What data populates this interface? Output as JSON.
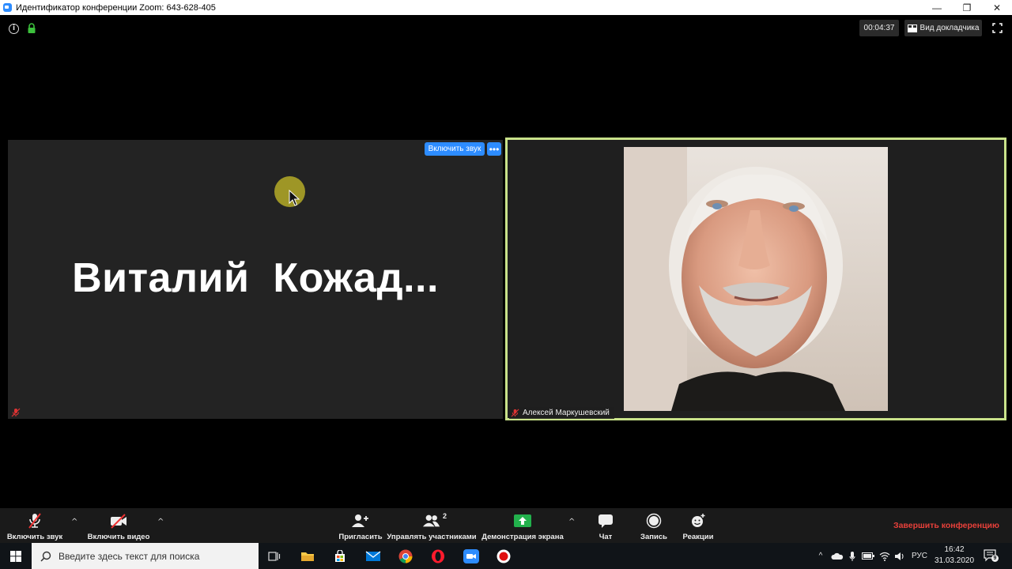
{
  "window": {
    "title": "Идентификатор конференции Zoom: 643-628-405"
  },
  "topbar": {
    "timer": "00:04:37",
    "speaker_view_label": "Вид докладчика"
  },
  "left_tile": {
    "unmute_label": "Включить звук",
    "more_label": "•••",
    "participant_name": "Виталий  Кожад..."
  },
  "right_tile": {
    "participant_name": "Алексей Маркушевский",
    "border_color": "#c9e28a"
  },
  "toolbar": {
    "audio_label": "Включить звук",
    "video_label": "Включить видео",
    "invite_label": "Пригласить",
    "participants_label": "Управлять участниками",
    "participants_count": "2",
    "share_label": "Демонстрация экрана",
    "chat_label": "Чат",
    "record_label": "Запись",
    "reactions_label": "Реакции",
    "end_label": "Завершить конференцию",
    "end_color": "#e8403a",
    "share_color": "#22b14c"
  },
  "taskbar": {
    "search_placeholder": "Введите здесь текст для поиска",
    "language": "РУС",
    "time": "16:42",
    "date": "31.03.2020",
    "notification_count": "9"
  },
  "icons": [
    "info-icon",
    "lock-icon",
    "grid-icon",
    "fullscreen-icon",
    "mic-muted-icon",
    "video-off-icon",
    "add-user-icon",
    "users-icon",
    "share-screen-icon",
    "chat-icon",
    "record-icon",
    "reactions-icon",
    "windows-icon",
    "search-icon"
  ]
}
